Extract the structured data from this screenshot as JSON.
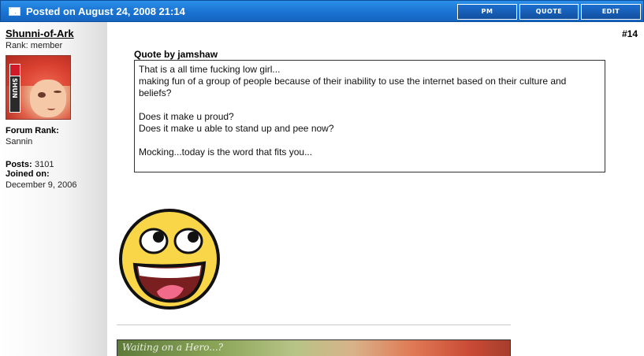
{
  "header": {
    "posted_text": "Posted on August 24, 2008 21:14",
    "buttons": {
      "pm": "PM",
      "quote": "QUOTE",
      "edit": "EDIT"
    },
    "icon": "envelope-icon",
    "accent_color": "#1a73d2"
  },
  "user": {
    "name": "Shunni-of-Ark",
    "rank_line": "Rank: member",
    "avatar_tag": "SHUN",
    "forum_rank_label": "Forum Rank:",
    "forum_rank_value": "Sannin",
    "posts_label": "Posts:",
    "posts_value": "3101",
    "joined_label": "Joined on:",
    "joined_value": "December 9, 2006"
  },
  "post": {
    "number": "#14",
    "quote_by": "Quote by jamshaw",
    "quote_lines": [
      "That is a all time fucking low girl...",
      "making fun of a group of people because of their inability to use the internet based on their culture and beliefs?",
      "",
      "Does it make u proud?",
      "Does it make u able to stand up and pee now?",
      "",
      "Mocking...today is the word that fits you..."
    ],
    "image": "awesome-smiley-image",
    "signature_text": "Waiting on a Hero...?"
  }
}
